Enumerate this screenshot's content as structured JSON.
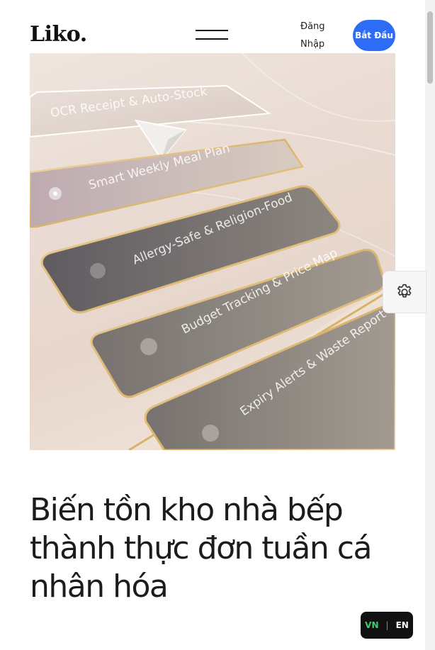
{
  "header": {
    "logo": "Liko.",
    "login_label": "Đăng Nhập",
    "start_label": "Bắt Đầu"
  },
  "hero": {
    "features": [
      "OCR Receipt & Auto-Stock",
      "Smart Weekly Meal Plan",
      "Allergy-Safe & Religion-Food",
      "Budget Tracking & Price Map",
      "Expiry Alerts & Waste Report"
    ]
  },
  "headline": "Biến tồn kho nhà bếp thành thực đơn tuần cá nhân hóa",
  "language": {
    "vn": "VN",
    "separator": "|",
    "en": "EN",
    "active": "VN"
  },
  "colors": {
    "accent": "#2f6cf6",
    "active_language": "#39d26a"
  },
  "icons": {
    "menu": "hamburger-icon",
    "settings": "gear-icon",
    "cursor": "pointer-arrow-icon"
  }
}
